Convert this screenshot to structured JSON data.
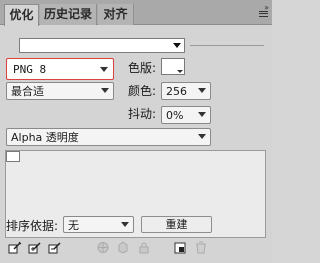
{
  "tabs": [
    {
      "label": "优化",
      "active": true
    },
    {
      "label": "历史记录",
      "active": false
    },
    {
      "label": "对齐",
      "active": false
    }
  ],
  "settings": {
    "preset_value": "",
    "format_value": "PNG 8",
    "reduction_value": "最合适",
    "colortable_label": "色版:",
    "colors_label": "颜色:",
    "colors_value": "256",
    "dither_label": "抖动:",
    "dither_value": "0%",
    "transparency_value": "Alpha 透明度"
  },
  "colors": {
    "highlight_border": "#d9453c",
    "panel_bg": "#d4d4d4",
    "tabbar_bg": "#a9a9a9"
  },
  "sort": {
    "label": "排序依据:",
    "value": "无",
    "rebuild_label": "重建"
  },
  "footer_icons": [
    "edit-color-icon",
    "edit-color-add-icon",
    "edit-color-remove-icon",
    "snap-web-icon",
    "lock-color-icon",
    "shift-color-icon",
    "new-color-icon",
    "delete-color-icon"
  ]
}
